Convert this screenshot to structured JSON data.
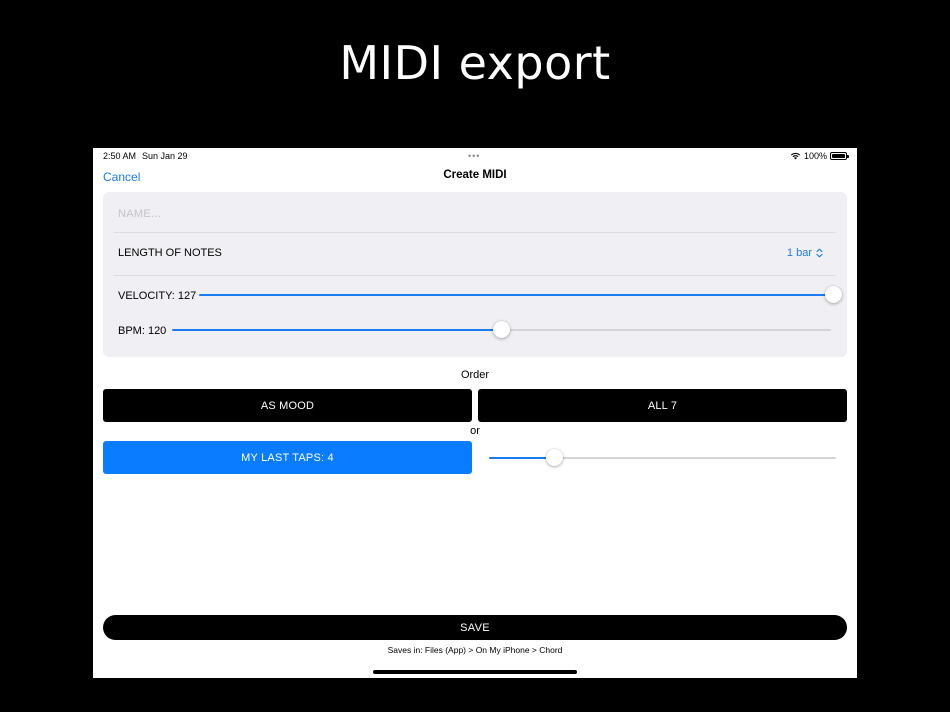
{
  "banner": {
    "title": "MIDI export"
  },
  "status_bar": {
    "time": "2:50 AM",
    "date": "Sun Jan 29",
    "battery": "100%"
  },
  "nav": {
    "cancel_label": "Cancel",
    "title": "Create MIDI"
  },
  "form": {
    "name_placeholder": "NAME...",
    "name_value": "",
    "length_label": "LENGTH OF NOTES",
    "length_value": "1 bar",
    "velocity_label": "VELOCITY: 127",
    "velocity_fraction": 1.0,
    "bpm_label": "BPM: 120",
    "bpm_fraction": 0.5
  },
  "order": {
    "label": "Order",
    "as_mood_label": "AS MOOD",
    "all_label": "ALL 7",
    "or_label": "or",
    "last_taps_label": "MY LAST TAPS: 4",
    "last_taps_fraction": 0.19
  },
  "footer": {
    "save_label": "SAVE",
    "save_path": "Saves in: Files (App) > On My iPhone > Chord"
  },
  "colors": {
    "accent": "#1a7cf0",
    "button_blue": "#0a7cff",
    "card_bg": "#efeff4"
  },
  "icons": {
    "wifi": "wifi-icon",
    "battery": "battery-icon",
    "picker": "chevron-up-down-icon"
  }
}
